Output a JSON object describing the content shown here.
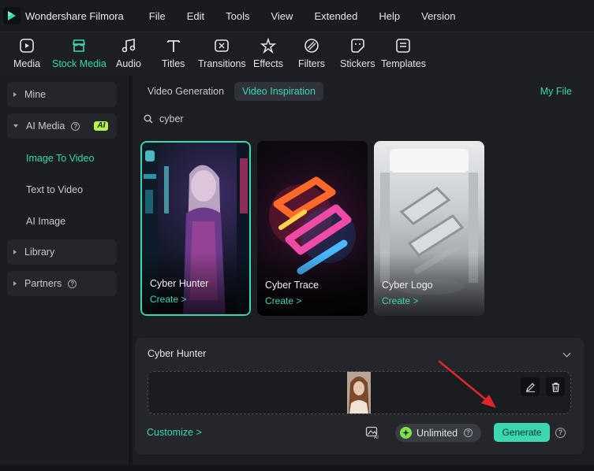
{
  "app": {
    "name": "Wondershare Filmora"
  },
  "menu": [
    "File",
    "Edit",
    "Tools",
    "View",
    "Extended",
    "Help",
    "Version"
  ],
  "toolbar": [
    {
      "label": "Media",
      "icon": "media-icon"
    },
    {
      "label": "Stock Media",
      "icon": "stock-media-icon",
      "active": true
    },
    {
      "label": "Audio",
      "icon": "music-note-icon"
    },
    {
      "label": "Titles",
      "icon": "titles-icon"
    },
    {
      "label": "Transitions",
      "icon": "transitions-icon"
    },
    {
      "label": "Effects",
      "icon": "effects-icon"
    },
    {
      "label": "Filters",
      "icon": "filters-icon"
    },
    {
      "label": "Stickers",
      "icon": "stickers-icon"
    },
    {
      "label": "Templates",
      "icon": "templates-icon"
    }
  ],
  "sidebar": {
    "mine": "Mine",
    "ai_media": "AI Media",
    "ai_badge": "AI",
    "sub": [
      "Image To Video",
      "Text to Video",
      "AI Image"
    ],
    "library": "Library",
    "partners": "Partners"
  },
  "tabs": [
    "Video Generation",
    "Video Inspiration"
  ],
  "active_tab": "Video Inspiration",
  "my_file": "My File",
  "search": {
    "value": "cyber"
  },
  "cards": [
    {
      "title": "Cyber Hunter",
      "action": "Create >",
      "selected": true
    },
    {
      "title": "Cyber Trace",
      "action": "Create >"
    },
    {
      "title": "Cyber Logo",
      "action": "Create >"
    }
  ],
  "panel": {
    "title": "Cyber Hunter",
    "customize": "Customize >",
    "credits": "Unlimited",
    "generate": "Generate"
  },
  "colors": {
    "accent": "#3ad7b1",
    "ai_badge": "#b5f24a",
    "annotation_arrow": "#e0262b"
  }
}
